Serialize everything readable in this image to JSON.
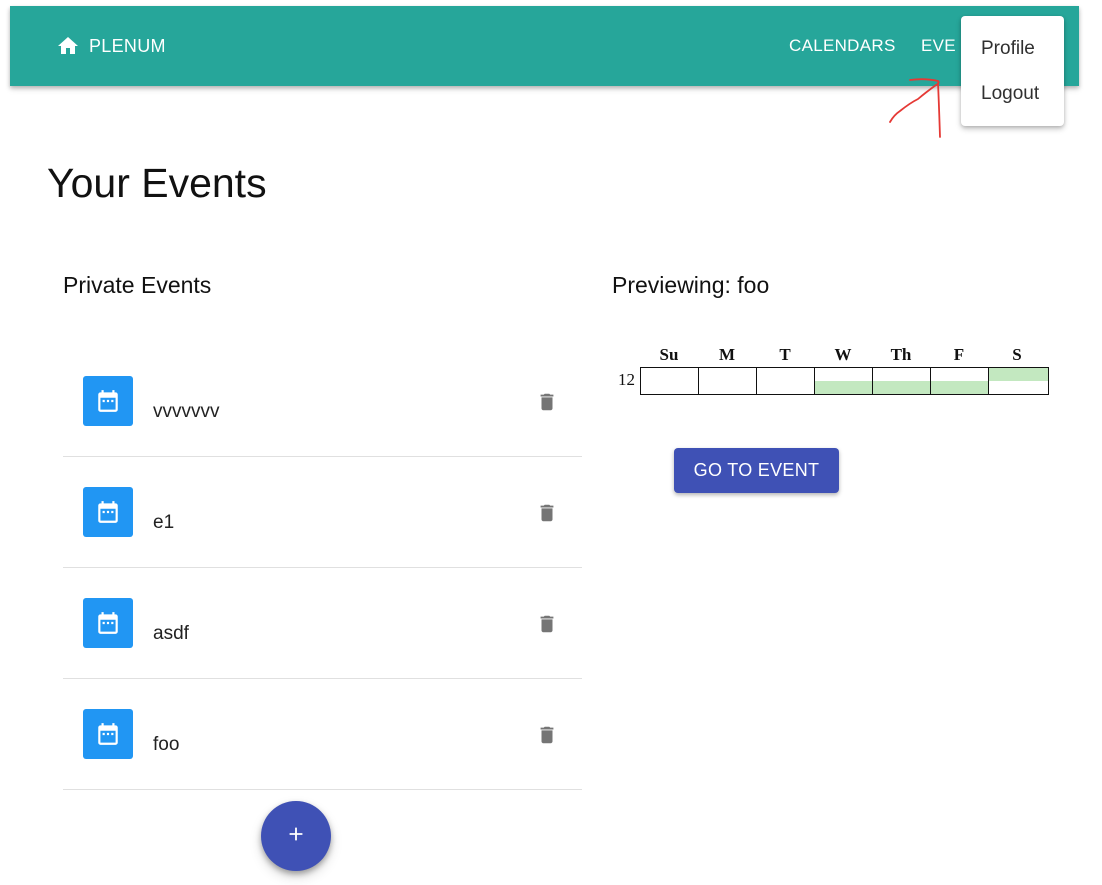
{
  "header": {
    "brand": "PLENUM",
    "nav": {
      "calendars": "CALENDARS",
      "events": "EVE"
    },
    "bg_color": "#26a69a"
  },
  "user_menu": {
    "items": [
      "Profile",
      "Logout"
    ]
  },
  "page": {
    "title": "Your Events"
  },
  "private_events": {
    "title": "Private Events",
    "items": [
      {
        "name": "vvvvvvv",
        "icon": "calendar-icon"
      },
      {
        "name": "e1",
        "icon": "calendar-icon"
      },
      {
        "name": "asdf",
        "icon": "calendar-icon"
      },
      {
        "name": "foo",
        "icon": "calendar-icon"
      }
    ],
    "add_icon": "plus-icon",
    "delete_icon": "trash-icon"
  },
  "preview": {
    "title": "Previewing: foo",
    "days": [
      "Su",
      "M",
      "T",
      "W",
      "Th",
      "F",
      "S"
    ],
    "row_label": "12",
    "availability": [
      {
        "day": "Su",
        "filled": "none"
      },
      {
        "day": "M",
        "filled": "none"
      },
      {
        "day": "T",
        "filled": "none"
      },
      {
        "day": "W",
        "filled": "bottom-half"
      },
      {
        "day": "Th",
        "filled": "bottom-half"
      },
      {
        "day": "F",
        "filled": "bottom-half"
      },
      {
        "day": "S",
        "filled": "top-half"
      }
    ],
    "fill_color": "#c3e8c0",
    "go_button": "GO TO EVENT"
  },
  "colors": {
    "primary": "#3f51b5",
    "avatar": "#2196f3",
    "teal": "#26a69a"
  }
}
